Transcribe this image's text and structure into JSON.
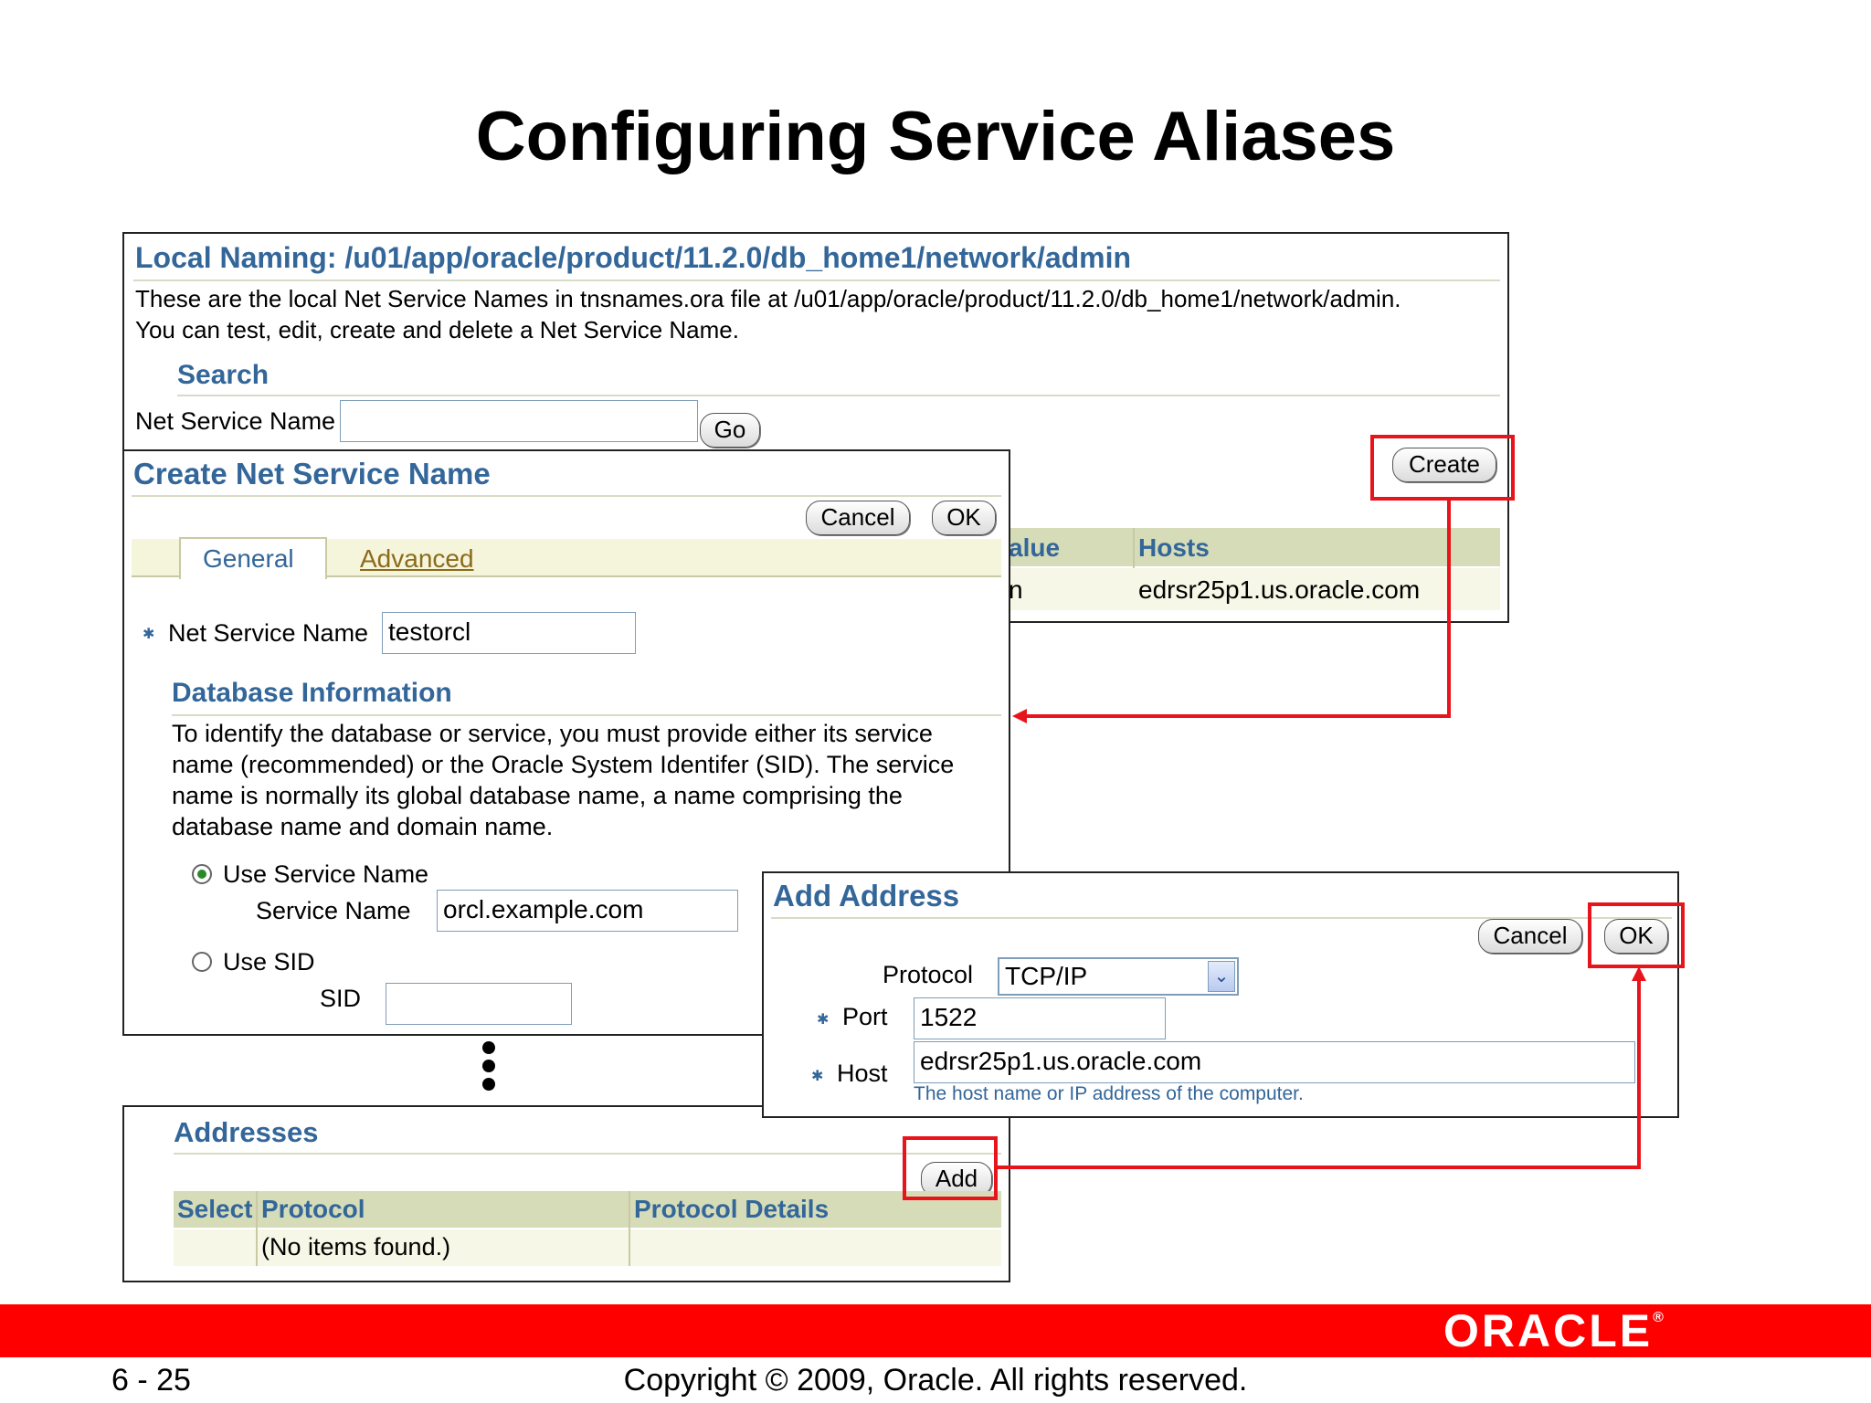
{
  "slide": {
    "title": "Configuring Service Aliases",
    "page_number": "6 - 25",
    "copyright": "Copyright © 2009, Oracle. All rights reserved.",
    "brand": "ORACLE",
    "brand_mark": "®"
  },
  "local_naming": {
    "title": "Local Naming: /u01/app/oracle/product/11.2.0/db_home1/network/admin",
    "description_line1": "These are the local Net Service Names in tnsnames.ora file at /u01/app/oracle/product/11.2.0/db_home1/network/admin.",
    "description_line2": "You can test, edit, create and delete a Net Service Name.",
    "search_heading": "Search",
    "search_label": "Net Service Name",
    "search_value": "",
    "go_label": "Go",
    "create_label": "Create",
    "columns": [
      "alue",
      "Hosts"
    ],
    "rows": [
      [
        "n",
        "edrsr25p1.us.oracle.com"
      ]
    ]
  },
  "create_nsn": {
    "title": "Create Net Service Name",
    "cancel_label": "Cancel",
    "ok_label": "OK",
    "tabs": [
      "General",
      "Advanced"
    ],
    "active_tab": "General",
    "nsn_label": "Net Service Name",
    "nsn_value": "testorcl",
    "db_info_heading": "Database Information",
    "db_info_text": [
      "To identify the database or service, you must provide either its service",
      "name (recommended) or the Oracle System Identifer (SID). The service",
      "name is normally its global database name, a name comprising the",
      "database name and domain name."
    ],
    "use_service_name_label": "Use Service Name",
    "service_name_label": "Service Name",
    "service_name_value": "orcl.example.com",
    "use_sid_label": "Use SID",
    "sid_label": "SID",
    "sid_value": "",
    "selected_option": "Use Service Name"
  },
  "addresses": {
    "title": "Addresses",
    "add_label": "Add",
    "columns": [
      "Select",
      "Protocol",
      "Protocol Details"
    ],
    "empty_text": "(No items found.)"
  },
  "add_address": {
    "title": "Add Address",
    "cancel_label": "Cancel",
    "ok_label": "OK",
    "protocol_label": "Protocol",
    "protocol_value": "TCP/IP",
    "port_label": "Port",
    "port_value": "1522",
    "host_label": "Host",
    "host_value": "edrsr25p1.us.oracle.com",
    "host_hint": "The host name or IP address of the computer."
  },
  "colors": {
    "heading_blue": "#336699",
    "highlight_red": "#e8141c",
    "table_header": "#d6dcb8",
    "footer_red": "#ff0000"
  }
}
